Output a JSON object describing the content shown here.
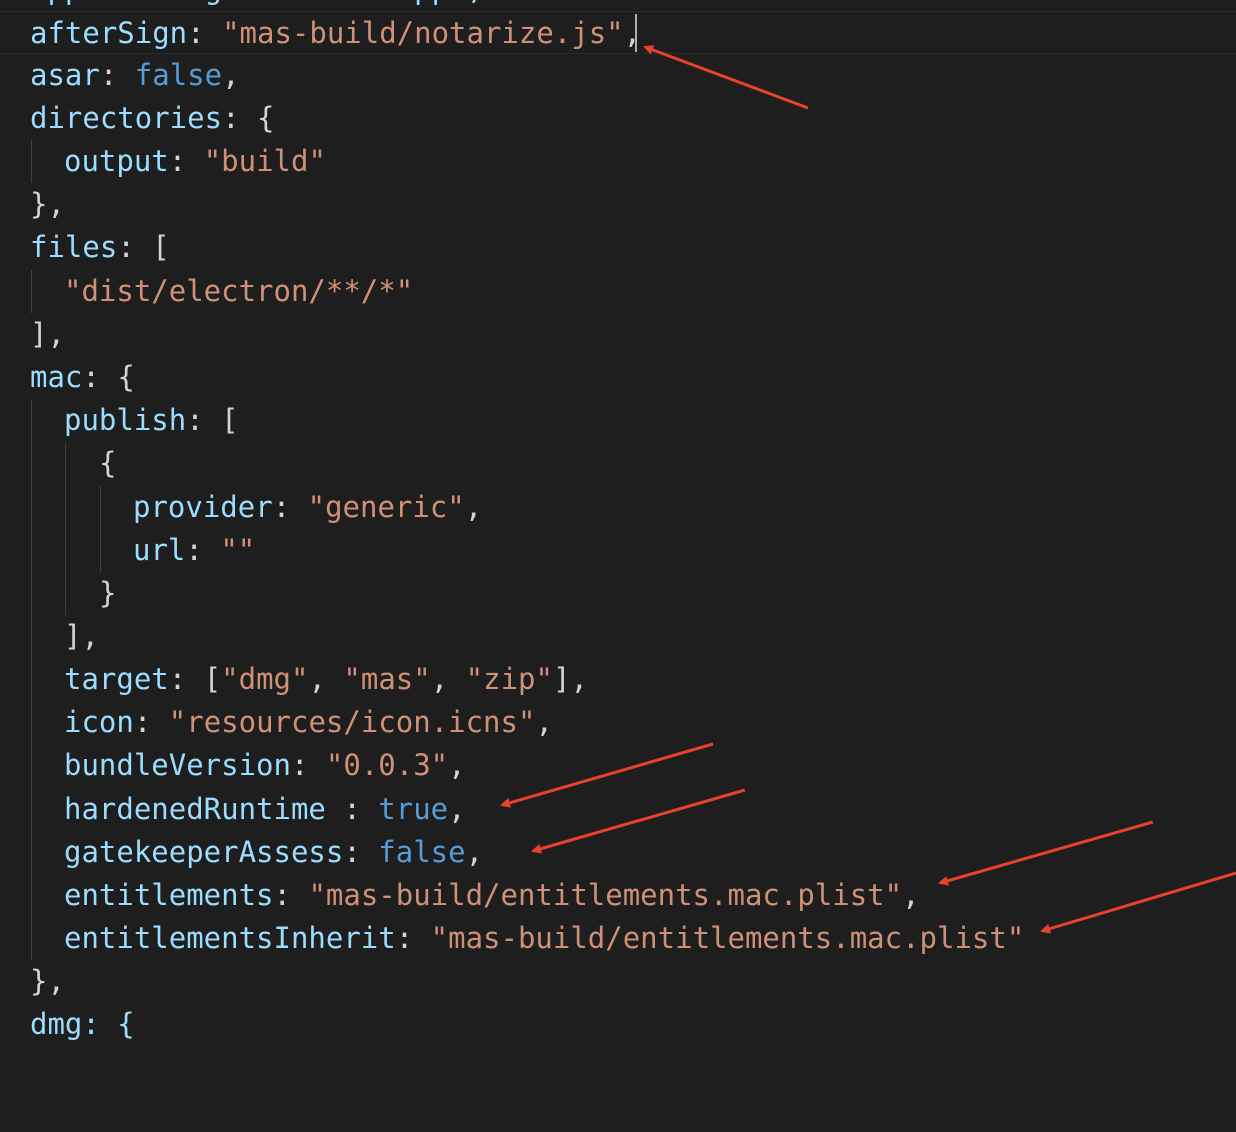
{
  "lines": {
    "l0": {
      "text": "appId: \"org.electron.app\","
    },
    "l1": {
      "key": "afterSign",
      "colon": ":",
      "value": "\"mas-build/notarize.js\"",
      "trail": ","
    },
    "l2": {
      "key": "asar",
      "colon": ":",
      "value": "false",
      "trail": ","
    },
    "l3": {
      "key": "directories",
      "colon": ":",
      "trail": "{"
    },
    "l4": {
      "key": "output",
      "colon": ":",
      "value": "\"build\""
    },
    "l5": {
      "text": "},"
    },
    "l6": {
      "key": "files",
      "colon": ":",
      "trail": "["
    },
    "l7": {
      "value": "\"dist/electron/**/*\""
    },
    "l8": {
      "text": "],"
    },
    "l9": {
      "key": "mac",
      "colon": ":",
      "trail": "{"
    },
    "l10": {
      "key": "publish",
      "colon": ":",
      "trail": "["
    },
    "l11": {
      "text": "{"
    },
    "l12": {
      "key": "provider",
      "colon": ":",
      "value": "\"generic\"",
      "trail": ","
    },
    "l13": {
      "key": "url",
      "colon": ":",
      "value": "\"\""
    },
    "l14": {
      "text": "}"
    },
    "l15": {
      "text": "],"
    },
    "l16": {
      "key": "target",
      "colon": ":",
      "open": "[",
      "v1": "\"dmg\"",
      "c1": ",",
      "v2": "\"mas\"",
      "c2": ",",
      "v3": "\"zip\"",
      "close": "],",
      "trail": ""
    },
    "l17": {
      "key": "icon",
      "colon": ":",
      "value": "\"resources/icon.icns\"",
      "trail": ","
    },
    "l18": {
      "key": "bundleVersion",
      "colon": ":",
      "value": "\"0.0.3\"",
      "trail": ","
    },
    "l19": {
      "key": "hardenedRuntime",
      "colon": " :",
      "value": "true",
      "trail": ","
    },
    "l20": {
      "key": "gatekeeperAssess",
      "colon": ":",
      "value": "false",
      "trail": ","
    },
    "l21": {
      "key": "entitlements",
      "colon": ":",
      "value": "\"mas-build/entitlements.mac.plist\"",
      "trail": ","
    },
    "l22": {
      "key": "entitlementsInherit",
      "colon": ":",
      "value": "\"mas-build/entitlements.mac.plist\""
    },
    "l23": {
      "text": "},"
    },
    "l24": {
      "text": "dmg: {"
    }
  },
  "colors": {
    "background": "#1e1e1e",
    "key": "#9cdcfe",
    "string": "#ce9178",
    "boolean": "#569cd6",
    "punctuation": "#d4d4d4",
    "annotation_arrow": "#e8412c"
  }
}
